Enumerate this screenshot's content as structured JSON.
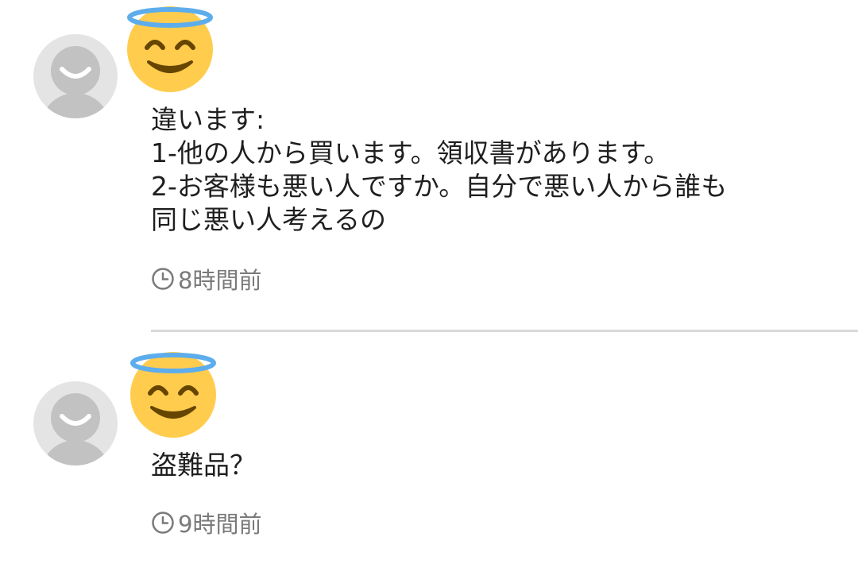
{
  "comments": [
    {
      "avatar_icon": "default-user-avatar",
      "badge_icon": "smiling-face-with-halo-emoji",
      "lines": [
        "違います:",
        "1-他の人から買います。領収書があります。",
        "2-お客様も悪い人ですか。自分で悪い人から誰も",
        "同じ悪い人考えるの"
      ],
      "time_icon": "clock-icon",
      "time": "8時間前"
    },
    {
      "avatar_icon": "default-user-avatar",
      "badge_icon": "smiling-face-with-halo-emoji",
      "lines": [
        "盗難品？"
      ],
      "time_icon": "clock-icon",
      "time": "9時間前"
    }
  ],
  "colors": {
    "avatar_bg": "#e4e4e4",
    "avatar_figure": "#c2c2c2",
    "emoji_face": "#ffcc4d",
    "emoji_halo": "#5dadec",
    "emoji_features": "#664500",
    "timestamp": "#7a7a7a",
    "divider": "#d9d9d9"
  }
}
